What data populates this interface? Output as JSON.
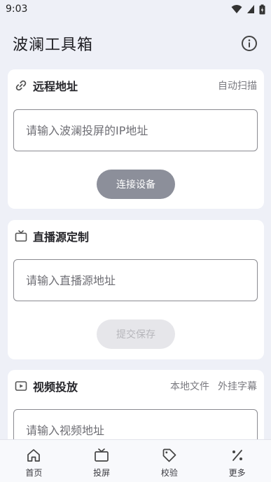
{
  "status_bar": {
    "time": "9:03"
  },
  "app_bar": {
    "title": "波澜工具箱"
  },
  "remote": {
    "title": "远程地址",
    "action": "自动扫描",
    "placeholder": "请输入波澜投屏的IP地址",
    "button": "连接设备"
  },
  "live": {
    "title": "直播源定制",
    "placeholder": "请输入直播源地址",
    "button": "提交保存"
  },
  "video": {
    "title": "视频投放",
    "action_local": "本地文件",
    "action_subtitle": "外挂字幕",
    "placeholder": "请输入视频地址"
  },
  "bottom_nav": [
    {
      "label": "首页",
      "icon": "home-icon"
    },
    {
      "label": "投屏",
      "icon": "tv-icon"
    },
    {
      "label": "校验",
      "icon": "tag-icon"
    },
    {
      "label": "更多",
      "icon": "more-icon"
    }
  ],
  "colors": {
    "background": "#eef0f7",
    "primary_button": "#8c8f9a",
    "disabled_button": "#e6e6ea"
  }
}
